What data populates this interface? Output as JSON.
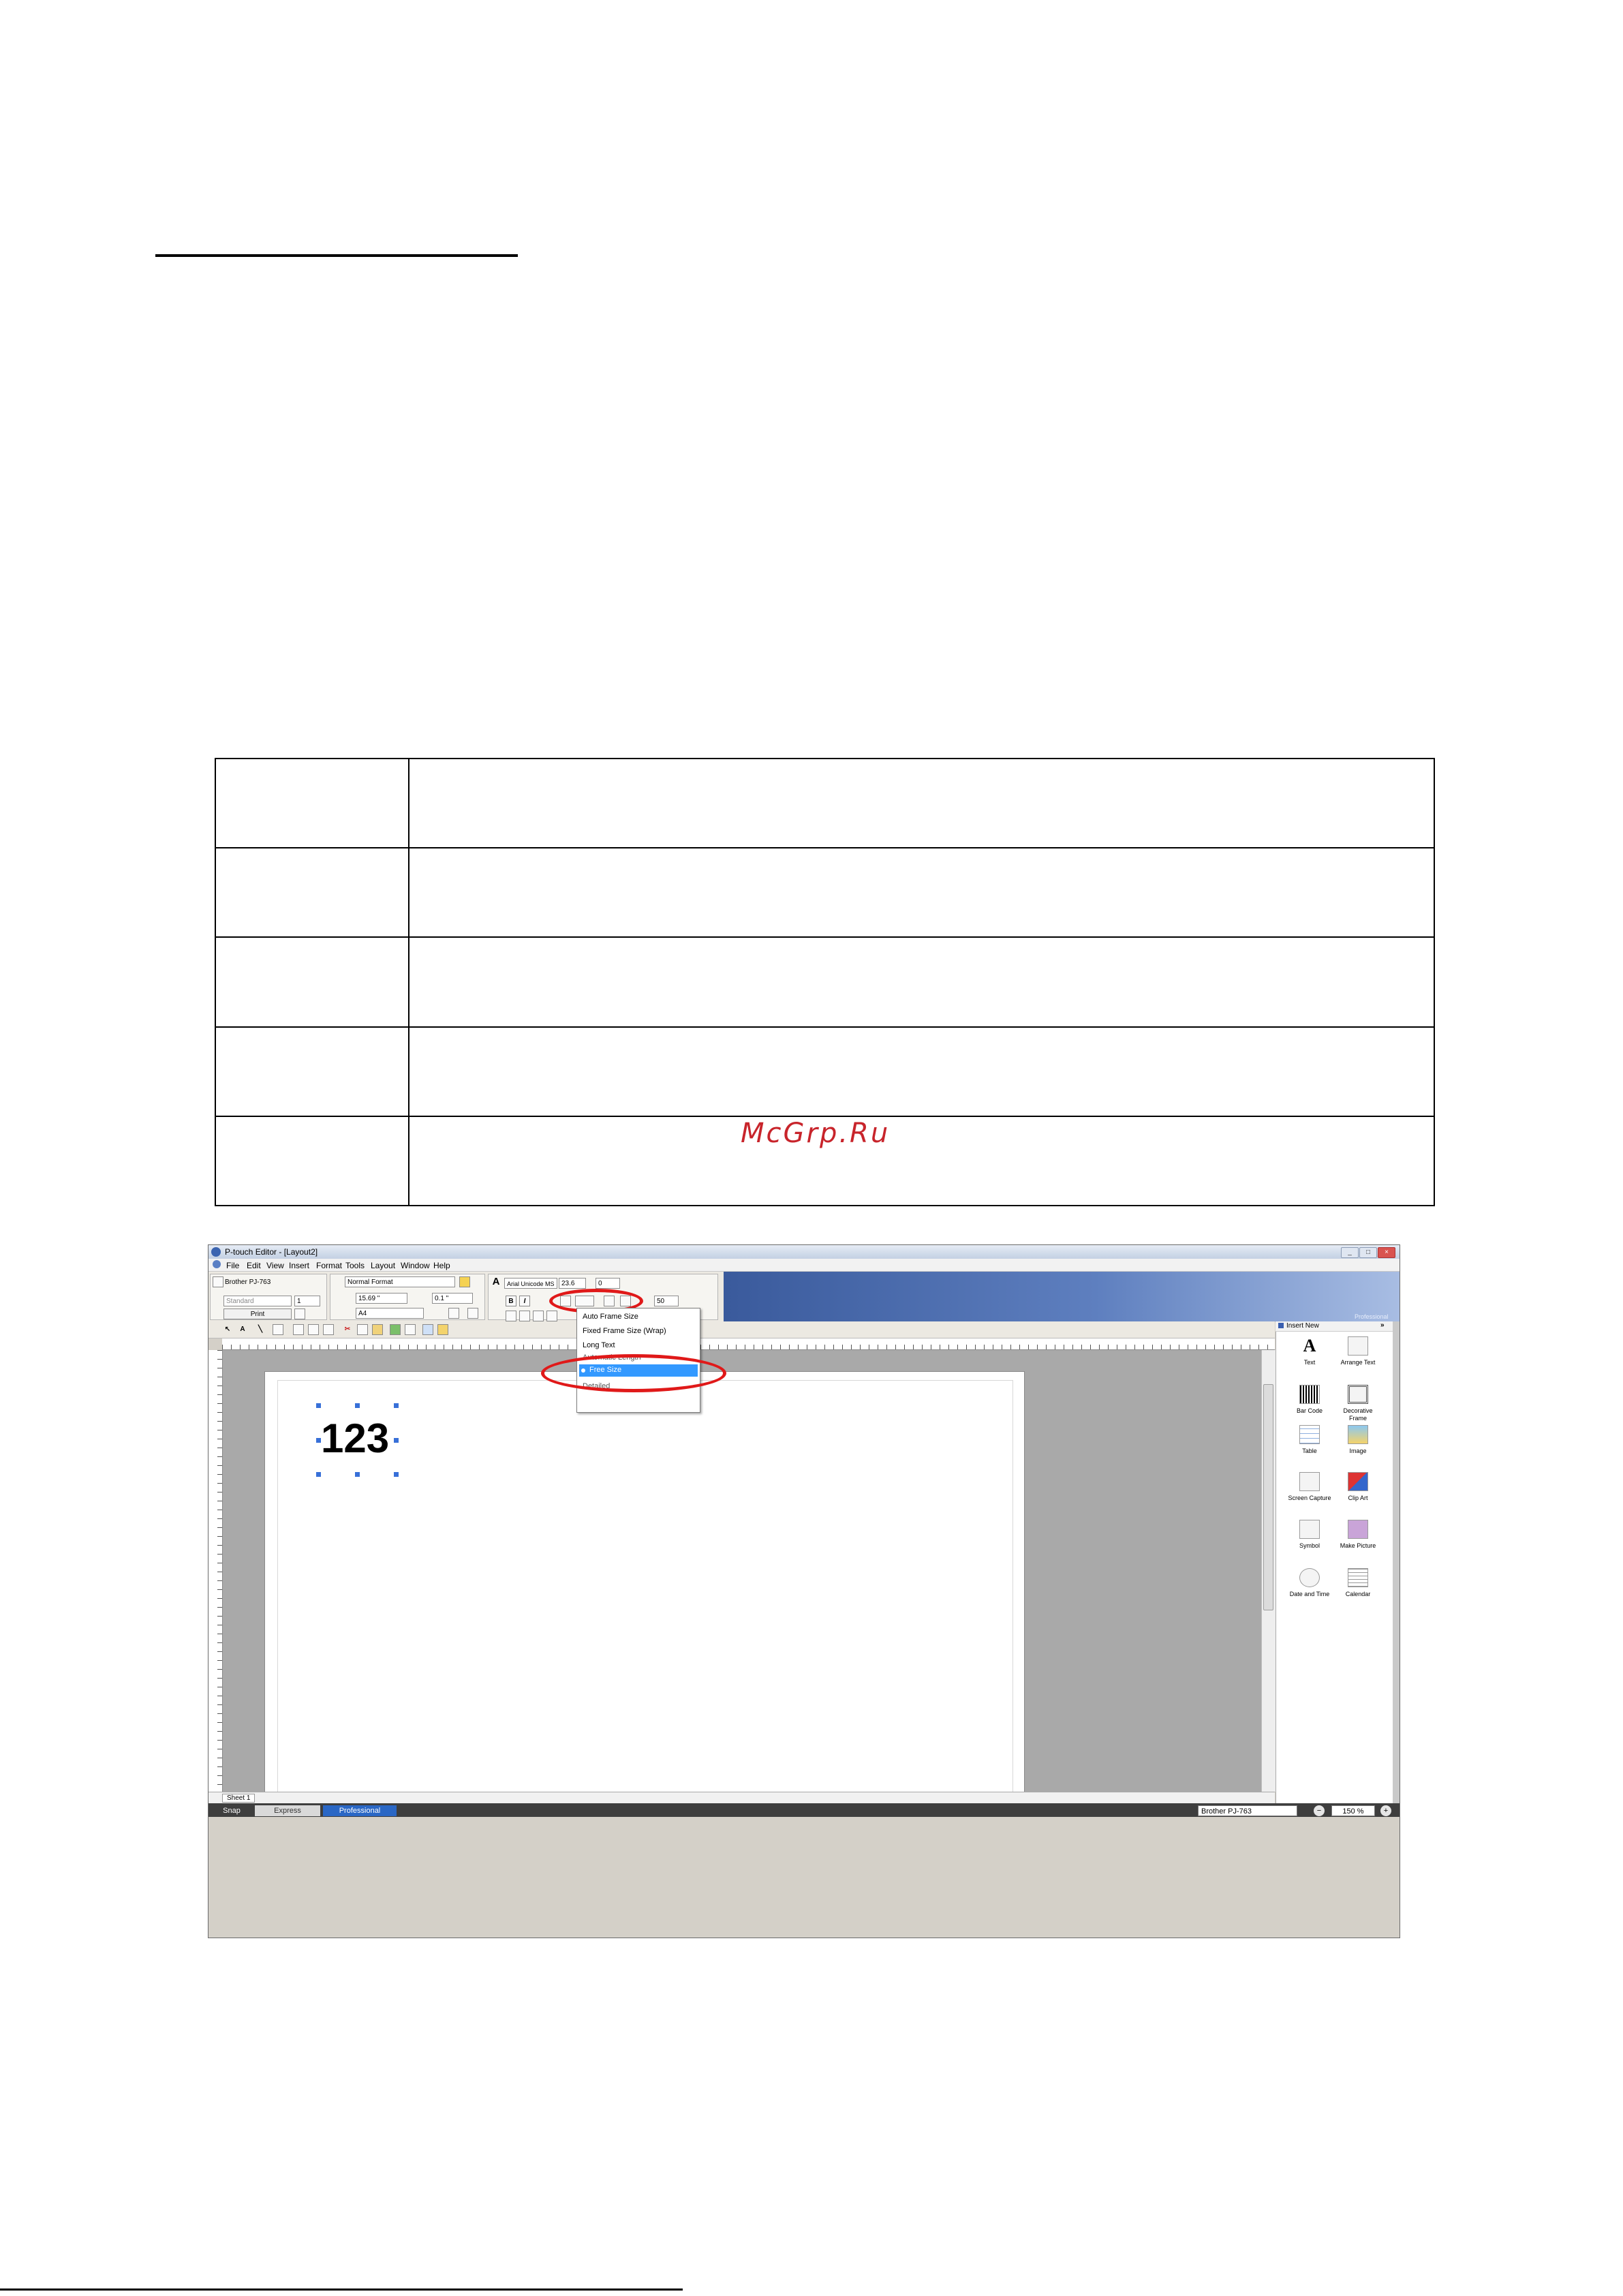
{
  "watermark": "McGrp.Ru",
  "table": {
    "rows": 5
  },
  "app": {
    "title": "P-touch Editor - [Layout2]",
    "window_buttons": {
      "minimize": "_",
      "restore": "□",
      "close": "×"
    },
    "menu": [
      "File",
      "Edit",
      "View",
      "Insert",
      "Format",
      "Tools",
      "Layout",
      "Window",
      "Help"
    ],
    "printer_panel": {
      "printer": "Brother PJ-763",
      "quality": "Standard",
      "copies": "1",
      "print": "Print"
    },
    "page_panel": {
      "format": "Normal Format",
      "length": "15.69 \"",
      "margin": "0.1 \"",
      "paper": "A4"
    },
    "font_panel": {
      "font": "Arial Unicode MS",
      "size": "23.6",
      "spacing": "0",
      "bold": "B",
      "italic": "I",
      "scale": "50"
    },
    "professional_watermark": "Professional",
    "dropdown": {
      "items": [
        "Auto Frame Size",
        "Fixed Frame Size (Wrap)",
        "Long Text",
        "Automatic Length",
        "Free Size",
        "Detailed"
      ],
      "selected": "Free Size"
    },
    "canvas_object": "123",
    "sheet_tab": "Sheet 1",
    "statusbar": {
      "snap": "Snap",
      "mode_express": "Express",
      "mode_professional": "Professional",
      "printer": "Brother PJ-763",
      "zoom": "150 %"
    },
    "insert_panel": {
      "title": "Insert New",
      "items": [
        "Text",
        "Arrange Text",
        "Bar Code",
        "Decorative Frame",
        "Table",
        "Image",
        "Screen Capture",
        "Clip Art",
        "Symbol",
        "Make Picture",
        "Date and Time",
        "Calendar"
      ]
    }
  }
}
